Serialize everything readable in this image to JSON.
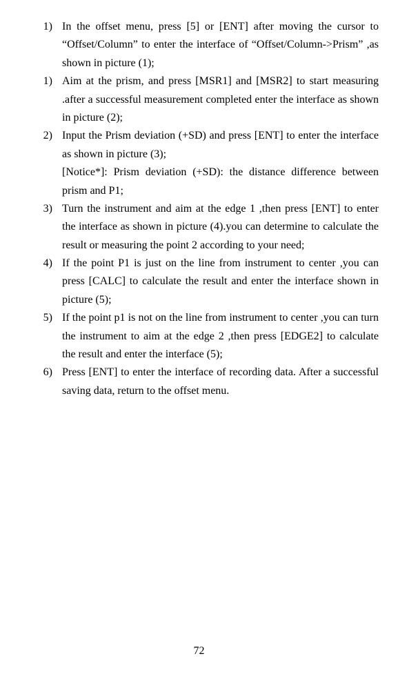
{
  "page_number": "72",
  "items": [
    {
      "number": "1)",
      "paragraphs": [
        "In the offset menu, press [5] or [ENT] after moving the cursor to “Offset/Column” to enter the interface of “Offset/Column->Prism” ,as shown in picture (1);"
      ]
    },
    {
      "number": "1)",
      "paragraphs": [
        "Aim at the prism, and press [MSR1] and [MSR2] to start measuring .after a successful measurement completed enter the interface as shown in picture (2);"
      ]
    },
    {
      "number": "2)",
      "paragraphs": [
        "Input the Prism deviation (+SD) and press [ENT] to enter the interface as shown in picture (3);",
        "[Notice*]: Prism deviation (+SD): the distance difference between prism and P1;"
      ]
    },
    {
      "number": "3)",
      "paragraphs": [
        "Turn the instrument and aim at the edge 1 ,then press [ENT] to enter the interface as shown in picture (4).you can determine to calculate the result or measuring the point 2 according to your need;"
      ]
    },
    {
      "number": "4)",
      "paragraphs": [
        "If the point P1 is just on the line from instrument to center ,you can press [CALC] to calculate the result and enter the interface shown in picture (5);"
      ]
    },
    {
      "number": "5)",
      "paragraphs": [
        "If the point p1 is not on the line from instrument to center ,you can turn the instrument to aim at the edge 2 ,then press [EDGE2] to calculate the result and enter the interface (5);"
      ]
    },
    {
      "number": "6)",
      "paragraphs": [
        "Press [ENT] to enter the interface of recording data. After a successful saving data, return to the offset menu."
      ]
    }
  ]
}
